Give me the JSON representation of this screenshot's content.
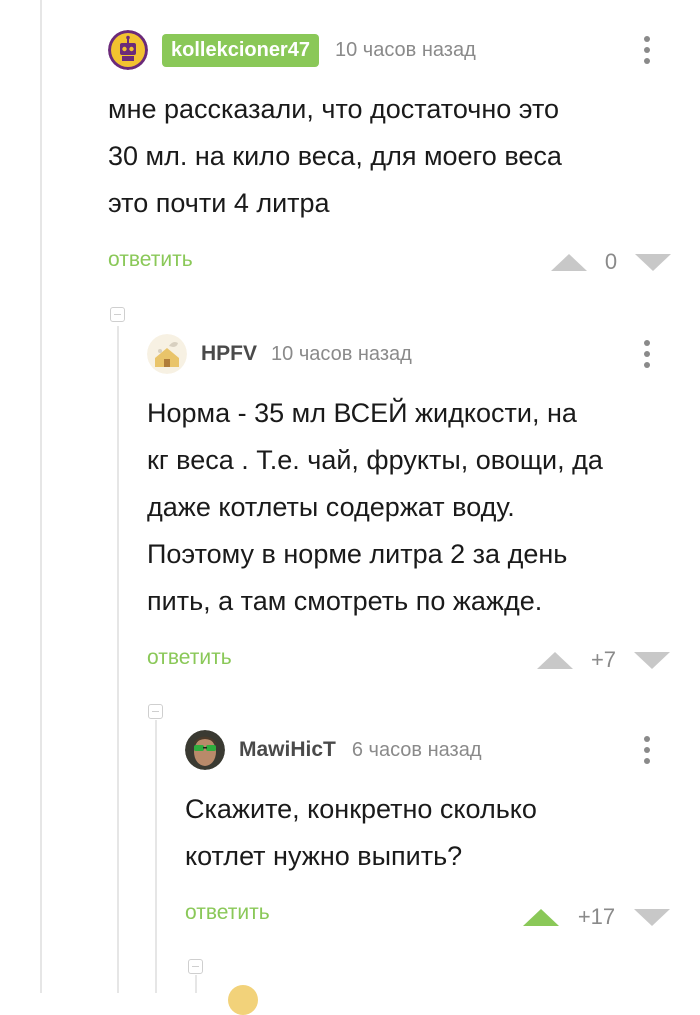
{
  "comments": [
    {
      "username": "kollekcioner47",
      "time": "10 часов назад",
      "text_lines": [
        "мне рассказали, что достаточно это",
        "30 мл. на кило веса, для моего веса",
        "это почти 4 литра"
      ],
      "reply_label": "ответить",
      "rating": "0",
      "avatar_icon": "robot-avatar-icon"
    },
    {
      "username": "HPFV",
      "time": "10 часов назад",
      "text_lines": [
        "Норма - 35 мл ВСЕЙ жидкости, на",
        "кг веса . Т.е. чай, фрукты, овощи, да",
        "даже котлеты содержат воду.",
        "Поэтому в норме литра 2 за день",
        "пить, а там смотреть по жажде."
      ],
      "reply_label": "ответить",
      "rating": "+7",
      "avatar_icon": "house-avatar-icon"
    },
    {
      "username": "MawiHicT",
      "time": "6 часов назад",
      "text_lines": [
        "Скажите, конкретно сколько",
        "котлет нужно выпить?"
      ],
      "reply_label": "ответить",
      "rating": "+17",
      "upvoted": true,
      "avatar_icon": "photo-avatar-icon"
    }
  ],
  "colors": {
    "accent_green": "#8ac858",
    "muted_gray": "#8a8a8a",
    "vote_gray": "#c8c8c8"
  }
}
